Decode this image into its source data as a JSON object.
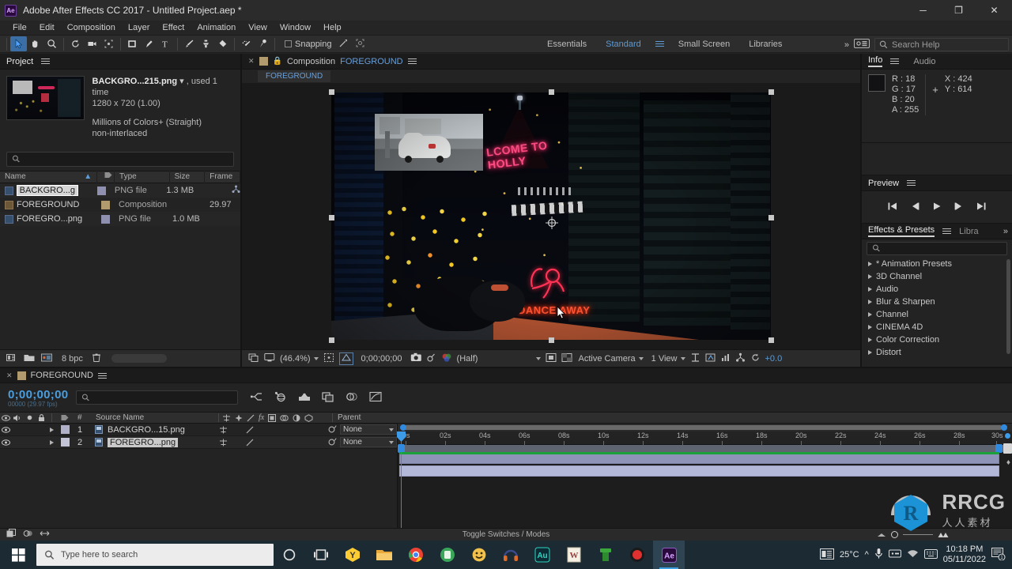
{
  "window": {
    "app_icon": "ae-logo-icon",
    "title": "Adobe After Effects CC 2017 - Untitled Project.aep *",
    "minimize": "─",
    "maximize": "❐",
    "close": "✕"
  },
  "menubar": {
    "items": [
      "File",
      "Edit",
      "Composition",
      "Layer",
      "Effect",
      "Animation",
      "View",
      "Window",
      "Help"
    ]
  },
  "toolbar": {
    "tools": [
      {
        "name": "selection-tool-icon",
        "active": true
      },
      {
        "name": "hand-tool-icon",
        "active": false
      },
      {
        "name": "zoom-tool-icon",
        "active": false
      },
      {
        "name": "rotation-tool-icon",
        "active": false
      },
      {
        "name": "camera-tool-icon",
        "active": false
      },
      {
        "name": "pan-behind-tool-icon",
        "active": false
      },
      {
        "name": "shape-tool-icon",
        "active": false
      },
      {
        "name": "pen-tool-icon",
        "active": false
      },
      {
        "name": "type-tool-icon",
        "active": false
      },
      {
        "name": "brush-tool-icon",
        "active": false
      },
      {
        "name": "clone-stamp-tool-icon",
        "active": false
      },
      {
        "name": "eraser-tool-icon",
        "active": false
      },
      {
        "name": "roto-brush-tool-icon",
        "active": false
      },
      {
        "name": "puppet-pin-tool-icon",
        "active": false
      }
    ],
    "snapping_label": "Snapping",
    "workspaces": [
      "Essentials",
      "Standard",
      "Small Screen",
      "Libraries"
    ],
    "workspace_selected": "Standard",
    "overflow": "»",
    "search_help_placeholder": "Search Help"
  },
  "project_panel": {
    "tabs": [
      "Project"
    ],
    "active_tab": "Project",
    "selected_item": {
      "name": "BACKGRO...215.png",
      "usage": ", used 1 time",
      "dimensions": "1280 x 720  (1.00)",
      "color_depth": "Millions of Colors+ (Straight)",
      "interlace": "non-interlaced"
    },
    "search_placeholder": "",
    "columns": [
      "Name",
      "Type",
      "Size",
      "Frame ..."
    ],
    "rows": [
      {
        "name": "BACKGRO...g",
        "type": "PNG file",
        "size": "1.3 MB",
        "frame": "",
        "selected": true,
        "kind": "png"
      },
      {
        "name": "FOREGROUND",
        "type": "Composition",
        "size": "",
        "frame": "29.97",
        "selected": false,
        "kind": "comp"
      },
      {
        "name": "FOREGRO...png",
        "type": "PNG file",
        "size": "1.0 MB",
        "frame": "",
        "selected": false,
        "kind": "png"
      }
    ],
    "footer": {
      "bit_depth": "8 bpc"
    }
  },
  "composition_panel": {
    "tab_label": "Composition",
    "tab_comp_name": "FOREGROUND",
    "comp_chip": "FOREGROUND",
    "viewer": {
      "neon_welcome": "LCOME TO HOLLY",
      "neon_dance": "DANCE AWAY",
      "zoom": "(46.4%)",
      "timecode": "0;00;00;00",
      "resolution": "(Half)",
      "view_camera": "Active Camera",
      "view_layout": "1 View",
      "exposure": "+0.0"
    }
  },
  "info_panel": {
    "tabs": [
      "Info",
      "Audio"
    ],
    "active_tab": "Info",
    "r_label": "R :",
    "r_value": "18",
    "g_label": "G :",
    "g_value": "17",
    "b_label": "B :",
    "b_value": "20",
    "a_label": "A :",
    "a_value": "255",
    "x_label": "X :",
    "x_value": "424",
    "y_label": "Y :",
    "y_value": "614",
    "swatch_color": "#121214"
  },
  "preview_panel": {
    "title": "Preview",
    "controls": [
      "first-frame-icon",
      "previous-frame-icon",
      "play-icon",
      "next-frame-icon",
      "last-frame-icon"
    ]
  },
  "effects_panel": {
    "tabs": [
      "Effects & Presets",
      "Libra"
    ],
    "active_tab": "Effects & Presets",
    "overflow": "»",
    "search_placeholder": "",
    "items": [
      "* Animation Presets",
      "3D Channel",
      "Audio",
      "Blur & Sharpen",
      "Channel",
      "CINEMA 4D",
      "Color Correction",
      "Distort"
    ]
  },
  "timeline_panel": {
    "tab_label": "FOREGROUND",
    "timecode": "0;00;00;00",
    "timecode_sub": "00000 (29.97 fps)",
    "search_placeholder": "",
    "tools": [
      "composition-mini-flowchart-icon",
      "draft-3d-icon",
      "hide-shy-layers-icon",
      "frame-blending-icon",
      "motion-blur-icon",
      "graph-editor-icon"
    ],
    "columns": {
      "number": "#",
      "source_name": "Source Name",
      "switches": "⚓ ✲ ╲ fx ▣ ◎ ◐ ⬡",
      "parent": "Parent"
    },
    "layers": [
      {
        "index": "1",
        "name": "BACKGRO...15.png",
        "parent": "None",
        "selected": false,
        "bar_color": "#8e94b8"
      },
      {
        "index": "2",
        "name": "FOREGRO...png",
        "parent": "None",
        "selected": true,
        "bar_color": "#b3b7d8"
      }
    ],
    "ruler_ticks": [
      "0s",
      "02s",
      "04s",
      "06s",
      "08s",
      "10s",
      "12s",
      "14s",
      "16s",
      "18s",
      "20s",
      "22s",
      "24s",
      "26s",
      "28s",
      "30s"
    ],
    "footer_label": "Toggle Switches / Modes"
  },
  "taskbar": {
    "search_placeholder": "Type here to search",
    "icons": [
      "cortana-icon",
      "task-view-icon",
      "yandex-icon",
      "file-explorer-icon",
      "chrome-icon",
      "green-app-icon",
      "emoji-app-icon",
      "headphone-app-icon",
      "audition-icon",
      "word-icon",
      "green-pipe-icon",
      "record-app-icon",
      "after-effects-icon"
    ],
    "weather": "25°C",
    "tray": [
      "news-icon",
      "chevron-up-icon",
      "microphone-icon",
      "input-method-icon",
      "network-icon",
      "keyboard-icon"
    ],
    "time": "10:18 PM",
    "date": "05/11/2022",
    "notification_count": "1"
  },
  "watermark": {
    "text": "RRCG",
    "subtitle": "人人素材",
    "logo_color": "#1b9ae0"
  }
}
